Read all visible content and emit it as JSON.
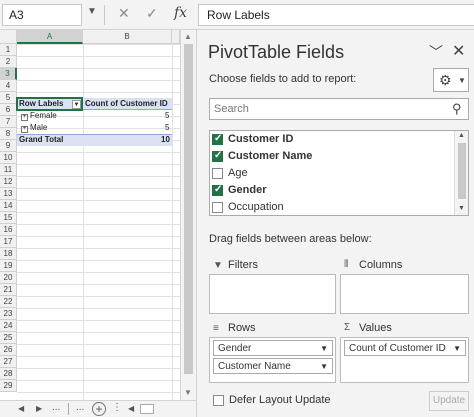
{
  "formula_bar": {
    "name_box": "A3",
    "fx": "fx",
    "content": "Row Labels"
  },
  "sheet": {
    "columns": [
      "A",
      "B"
    ],
    "rows": [
      "1",
      "2",
      "3",
      "4",
      "5",
      "6",
      "7",
      "8",
      "9",
      "10",
      "11",
      "12",
      "13",
      "14",
      "15",
      "16",
      "17",
      "18",
      "19",
      "20",
      "21",
      "22",
      "23",
      "24",
      "25",
      "26",
      "27",
      "28",
      "29"
    ],
    "pivot": {
      "header_a": "Row Labels",
      "header_b": "Count of Customer ID",
      "row1_label": "Female",
      "row1_value": "5",
      "row2_label": "Male",
      "row2_value": "5",
      "total_label": "Grand Total",
      "total_value": "10"
    }
  },
  "tabs_bar": {
    "dots": "..."
  },
  "pane": {
    "title": "PivotTable Fields",
    "subtitle": "Choose fields to add to report:",
    "search_placeholder": "Search",
    "fields": [
      {
        "label": "Customer ID",
        "checked": true
      },
      {
        "label": "Customer Name",
        "checked": true
      },
      {
        "label": "Age",
        "checked": false
      },
      {
        "label": "Gender",
        "checked": true
      },
      {
        "label": "Occupation",
        "checked": false
      }
    ],
    "drag_label": "Drag fields between areas below:",
    "filters_label": "Filters",
    "columns_label": "Columns",
    "rows_label": "Rows",
    "values_label": "Values",
    "rows_items": [
      "Gender",
      "Customer Name"
    ],
    "values_items": [
      "Count of Customer ID"
    ],
    "defer_label": "Defer Layout Update",
    "update_label": "Update"
  },
  "colors": {
    "accent": "#217346",
    "pivot_fill": "#d9e1f2"
  }
}
